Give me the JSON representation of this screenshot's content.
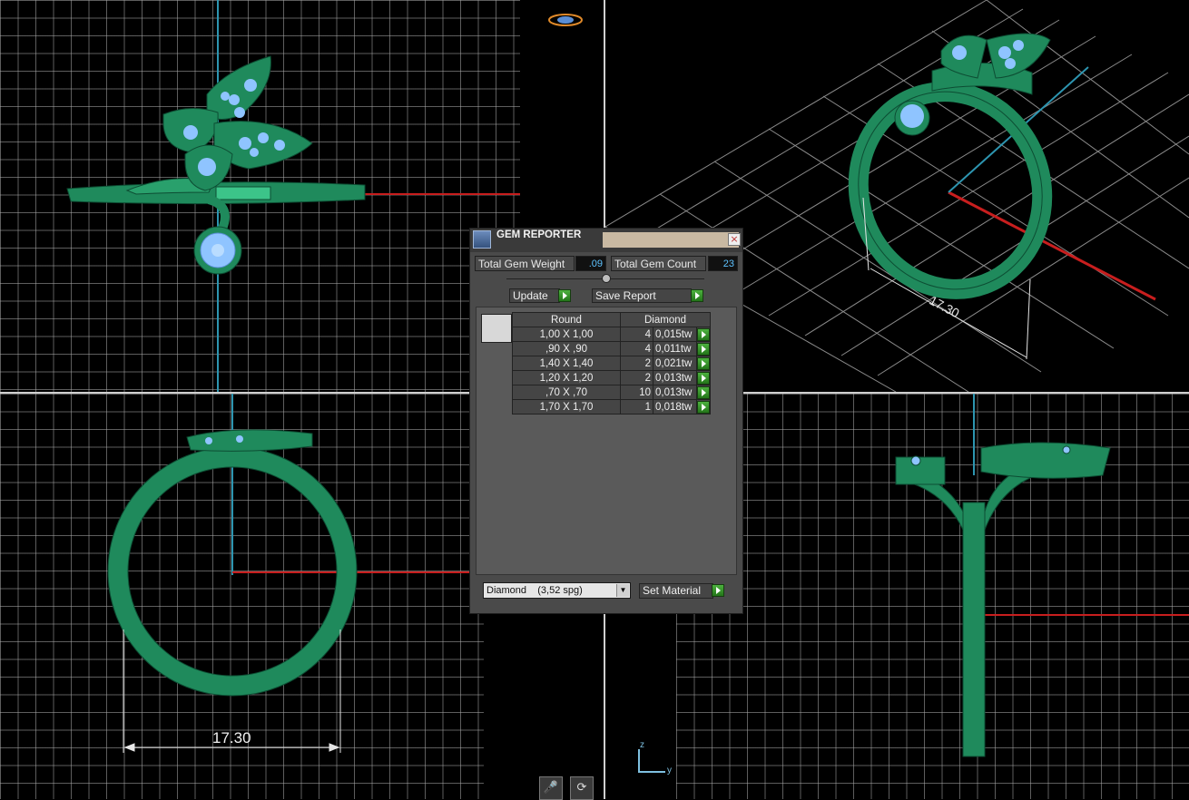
{
  "gem_reporter": {
    "title": "GEM REPORTER",
    "close": "×",
    "total_gem_weight_label": "Total Gem Weight",
    "total_gem_weight_value": ".09",
    "total_gem_count_label": "Total Gem Count",
    "total_gem_count_value": "23",
    "update_label": "Update",
    "save_report_label": "Save Report",
    "table": {
      "headers": [
        "Round",
        "Diamond"
      ],
      "rows": [
        {
          "size": "1,00 X 1,00",
          "count": "4",
          "weight": "0,015tw"
        },
        {
          "size": ",90 X ,90",
          "count": "4",
          "weight": "0,011tw"
        },
        {
          "size": "1,40 X 1,40",
          "count": "2",
          "weight": "0,021tw"
        },
        {
          "size": "1,20 X 1,20",
          "count": "2",
          "weight": "0,013tw"
        },
        {
          "size": ",70 X ,70",
          "count": "10",
          "weight": "0,013tw"
        },
        {
          "size": "1,70 X 1,70",
          "count": "1",
          "weight": "0,018tw"
        }
      ]
    },
    "material_select": "Diamond    (3,52 spg)",
    "set_material_label": "Set Material"
  },
  "viewports": {
    "perspective_dimension": "17.30",
    "front_dimension": "17.30",
    "axis_z": "z",
    "axis_y": "y"
  },
  "toolbar_icons": [
    "microphone-icon",
    "rotate-view-icon"
  ],
  "colors": {
    "ring": "#1f8a5c",
    "ring_light": "#35b57b",
    "gem": "#8fc4ff",
    "grid": "#9a9a9a",
    "axis_red": "#c81e1e",
    "axis_blue": "#2d95b0",
    "accent": "#3da62f"
  }
}
